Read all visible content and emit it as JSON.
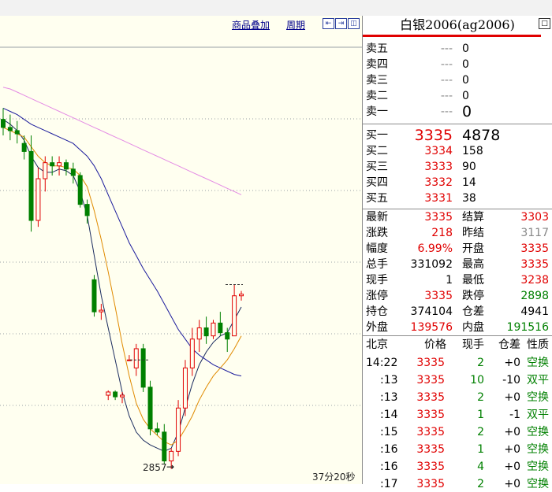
{
  "colors": {
    "up": "#e00000",
    "down": "#008000",
    "chart_bg": "#fffff0",
    "ma1": "#1a2b5e",
    "ma2": "#e08a00",
    "ma3": "#1c1c9c",
    "ma4": "#e48be4"
  },
  "toolbar": {
    "overlay_label": "商品叠加",
    "period_label": "周期",
    "icons": [
      "arrow-left-box-icon",
      "arrow-right-box-icon",
      "split-panel-icon"
    ]
  },
  "chart": {
    "low_label": "2857",
    "time_label": "37分20秒",
    "chart_data": {
      "type": "candlestick",
      "title": "",
      "series": [
        {
          "name": "",
          "values": []
        }
      ],
      "candles": [
        {
          "o": 3075,
          "h": 3082,
          "l": 3065,
          "c": 3070
        },
        {
          "o": 3070,
          "h": 3078,
          "l": 3062,
          "c": 3068
        },
        {
          "o": 3068,
          "h": 3074,
          "l": 3060,
          "c": 3066
        },
        {
          "o": 3060,
          "h": 3065,
          "l": 3050,
          "c": 3055
        },
        {
          "o": 3055,
          "h": 3065,
          "l": 3005,
          "c": 3012
        },
        {
          "o": 3012,
          "h": 3045,
          "l": 3008,
          "c": 3038
        },
        {
          "o": 3038,
          "h": 3052,
          "l": 3030,
          "c": 3048
        },
        {
          "o": 3048,
          "h": 3052,
          "l": 3040,
          "c": 3046
        },
        {
          "o": 3046,
          "h": 3052,
          "l": 3040,
          "c": 3048
        },
        {
          "o": 3048,
          "h": 3050,
          "l": 3040,
          "c": 3044
        },
        {
          "o": 3044,
          "h": 3048,
          "l": 3035,
          "c": 3040
        },
        {
          "o": 3040,
          "h": 3042,
          "l": 3020,
          "c": 3022
        },
        {
          "o": 3022,
          "h": 3025,
          "l": 3010,
          "c": 3015
        },
        {
          "o": 2975,
          "h": 2978,
          "l": 2952,
          "c": 2955
        },
        {
          "o": 2955,
          "h": 2960,
          "l": 2950,
          "c": 2956
        },
        {
          "o": 2903,
          "h": 2906,
          "l": 2900,
          "c": 2905
        },
        {
          "o": 2905,
          "h": 2906,
          "l": 2900,
          "c": 2902
        },
        {
          "o": 2902,
          "h": 2905,
          "l": 2898,
          "c": 2903
        },
        {
          "o": 2925,
          "h": 2928,
          "l": 2925,
          "c": 2925
        },
        {
          "o": 2920,
          "h": 2935,
          "l": 2915,
          "c": 2932
        },
        {
          "o": 2932,
          "h": 2935,
          "l": 2905,
          "c": 2908
        },
        {
          "o": 2908,
          "h": 2912,
          "l": 2878,
          "c": 2882
        },
        {
          "o": 2882,
          "h": 2886,
          "l": 2878,
          "c": 2880
        },
        {
          "o": 2880,
          "h": 2885,
          "l": 2860,
          "c": 2862
        },
        {
          "o": 2862,
          "h": 2870,
          "l": 2857,
          "c": 2868
        },
        {
          "o": 2868,
          "h": 2900,
          "l": 2865,
          "c": 2895
        },
        {
          "o": 2895,
          "h": 2925,
          "l": 2890,
          "c": 2920
        },
        {
          "o": 2920,
          "h": 2945,
          "l": 2915,
          "c": 2938
        },
        {
          "o": 2938,
          "h": 2950,
          "l": 2930,
          "c": 2945
        },
        {
          "o": 2945,
          "h": 2952,
          "l": 2935,
          "c": 2940
        },
        {
          "o": 2940,
          "h": 2950,
          "l": 2938,
          "c": 2948
        },
        {
          "o": 2948,
          "h": 2955,
          "l": 2940,
          "c": 2942
        },
        {
          "o": 2942,
          "h": 2945,
          "l": 2930,
          "c": 2938
        },
        {
          "o": 2940,
          "h": 2972,
          "l": 2940,
          "c": 2965
        },
        {
          "o": 2965,
          "h": 2968,
          "l": 2962,
          "c": 2966
        }
      ],
      "moving_averages": [
        {
          "color": "#1a2b5e",
          "values": [
            3075,
            3072,
            3068,
            3062,
            3052,
            3045,
            3042,
            3042,
            3044,
            3043,
            3040,
            3030,
            3015,
            2990,
            2965,
            2945,
            2925,
            2905,
            2890,
            2880,
            2875,
            2872,
            2870,
            2868,
            2870,
            2880,
            2895,
            2910,
            2922,
            2930,
            2936,
            2940,
            2942,
            2950,
            2958
          ]
        },
        {
          "color": "#e08a00",
          "values": [
            3070,
            3068,
            3066,
            3064,
            3058,
            3052,
            3048,
            3046,
            3046,
            3045,
            3044,
            3040,
            3033,
            3018,
            3000,
            2980,
            2958,
            2935,
            2915,
            2898,
            2888,
            2882,
            2878,
            2874,
            2872,
            2875,
            2882,
            2890,
            2900,
            2908,
            2915,
            2920,
            2925,
            2932,
            2940
          ]
        },
        {
          "color": "#1c1c9c",
          "values": [
            3082,
            3080,
            3078,
            3075,
            3072,
            3070,
            3068,
            3066,
            3064,
            3062,
            3060,
            3056,
            3052,
            3046,
            3038,
            3028,
            3018,
            3008,
            2998,
            2990,
            2982,
            2975,
            2968,
            2960,
            2952,
            2944,
            2938,
            2932,
            2928,
            2925,
            2922,
            2920,
            2918,
            2916,
            2915
          ]
        },
        {
          "color": "#e48be4",
          "values": [
            3095,
            3094,
            3092,
            3090,
            3088,
            3086,
            3084,
            3082,
            3080,
            3078,
            3076,
            3074,
            3072,
            3070,
            3068,
            3066,
            3064,
            3062,
            3060,
            3058,
            3056,
            3054,
            3052,
            3050,
            3048,
            3046,
            3044,
            3042,
            3040,
            3038,
            3036,
            3034,
            3032,
            3030,
            3028
          ]
        }
      ],
      "ylim": [
        2850,
        3120
      ],
      "grid": true
    }
  },
  "quote": {
    "title": "白银2006(ag2006)",
    "icon": "window-restore-icon",
    "asks": [
      {
        "label": "卖五",
        "price": "---",
        "vol": "0"
      },
      {
        "label": "卖四",
        "price": "---",
        "vol": "0"
      },
      {
        "label": "卖三",
        "price": "---",
        "vol": "0"
      },
      {
        "label": "卖二",
        "price": "---",
        "vol": "0"
      },
      {
        "label": "卖一",
        "price": "---",
        "vol": "0"
      }
    ],
    "bids": [
      {
        "label": "买一",
        "price": "3335",
        "vol": "4878"
      },
      {
        "label": "买二",
        "price": "3334",
        "vol": "158"
      },
      {
        "label": "买三",
        "price": "3333",
        "vol": "90"
      },
      {
        "label": "买四",
        "price": "3332",
        "vol": "14"
      },
      {
        "label": "买五",
        "price": "3331",
        "vol": "38"
      }
    ],
    "stats": [
      {
        "l1": "最新",
        "v1": "3335",
        "c1": "red",
        "l2": "结算",
        "v2": "3303",
        "c2": "red"
      },
      {
        "l1": "涨跌",
        "v1": "218",
        "c1": "red",
        "l2": "昨结",
        "v2": "3117",
        "c2": "gray"
      },
      {
        "l1": "幅度",
        "v1": "6.99%",
        "c1": "red",
        "l2": "开盘",
        "v2": "3335",
        "c2": "red"
      },
      {
        "l1": "总手",
        "v1": "331092",
        "c1": "",
        "l2": "最高",
        "v2": "3335",
        "c2": "red"
      },
      {
        "l1": "现手",
        "v1": "1",
        "c1": "",
        "l2": "最低",
        "v2": "3238",
        "c2": "red"
      },
      {
        "l1": "涨停",
        "v1": "3335",
        "c1": "red",
        "l2": "跌停",
        "v2": "2898",
        "c2": "grn"
      },
      {
        "l1": "持仓",
        "v1": "374104",
        "c1": "",
        "l2": "仓差",
        "v2": "4941",
        "c2": ""
      },
      {
        "l1": "外盘",
        "v1": "139576",
        "c1": "red",
        "l2": "内盘",
        "v2": "191516",
        "c2": "grn"
      }
    ],
    "ticks_header": {
      "time": "北京",
      "price": "价格",
      "vol": "现手",
      "diff": "仓差",
      "nature": "性质"
    },
    "ticks": [
      {
        "time": "14:22",
        "price": "3335",
        "vol": "2",
        "diff": "+0",
        "nature": "空换",
        "vc": "grn",
        "nc": "grn"
      },
      {
        "time": ":13",
        "price": "3335",
        "vol": "10",
        "diff": "-10",
        "nature": "双平",
        "vc": "grn",
        "nc": "grn"
      },
      {
        "time": ":13",
        "price": "3335",
        "vol": "2",
        "diff": "+0",
        "nature": "空换",
        "vc": "grn",
        "nc": "grn"
      },
      {
        "time": ":14",
        "price": "3335",
        "vol": "1",
        "diff": "-1",
        "nature": "双平",
        "vc": "grn",
        "nc": "grn"
      },
      {
        "time": ":15",
        "price": "3335",
        "vol": "2",
        "diff": "+0",
        "nature": "空换",
        "vc": "grn",
        "nc": "grn"
      },
      {
        "time": ":16",
        "price": "3335",
        "vol": "1",
        "diff": "+0",
        "nature": "空换",
        "vc": "grn",
        "nc": "grn"
      },
      {
        "time": ":16",
        "price": "3335",
        "vol": "4",
        "diff": "+0",
        "nature": "空换",
        "vc": "grn",
        "nc": "grn"
      },
      {
        "time": ":17",
        "price": "3335",
        "vol": "2",
        "diff": "+0",
        "nature": "空换",
        "vc": "grn",
        "nc": "grn"
      }
    ]
  }
}
